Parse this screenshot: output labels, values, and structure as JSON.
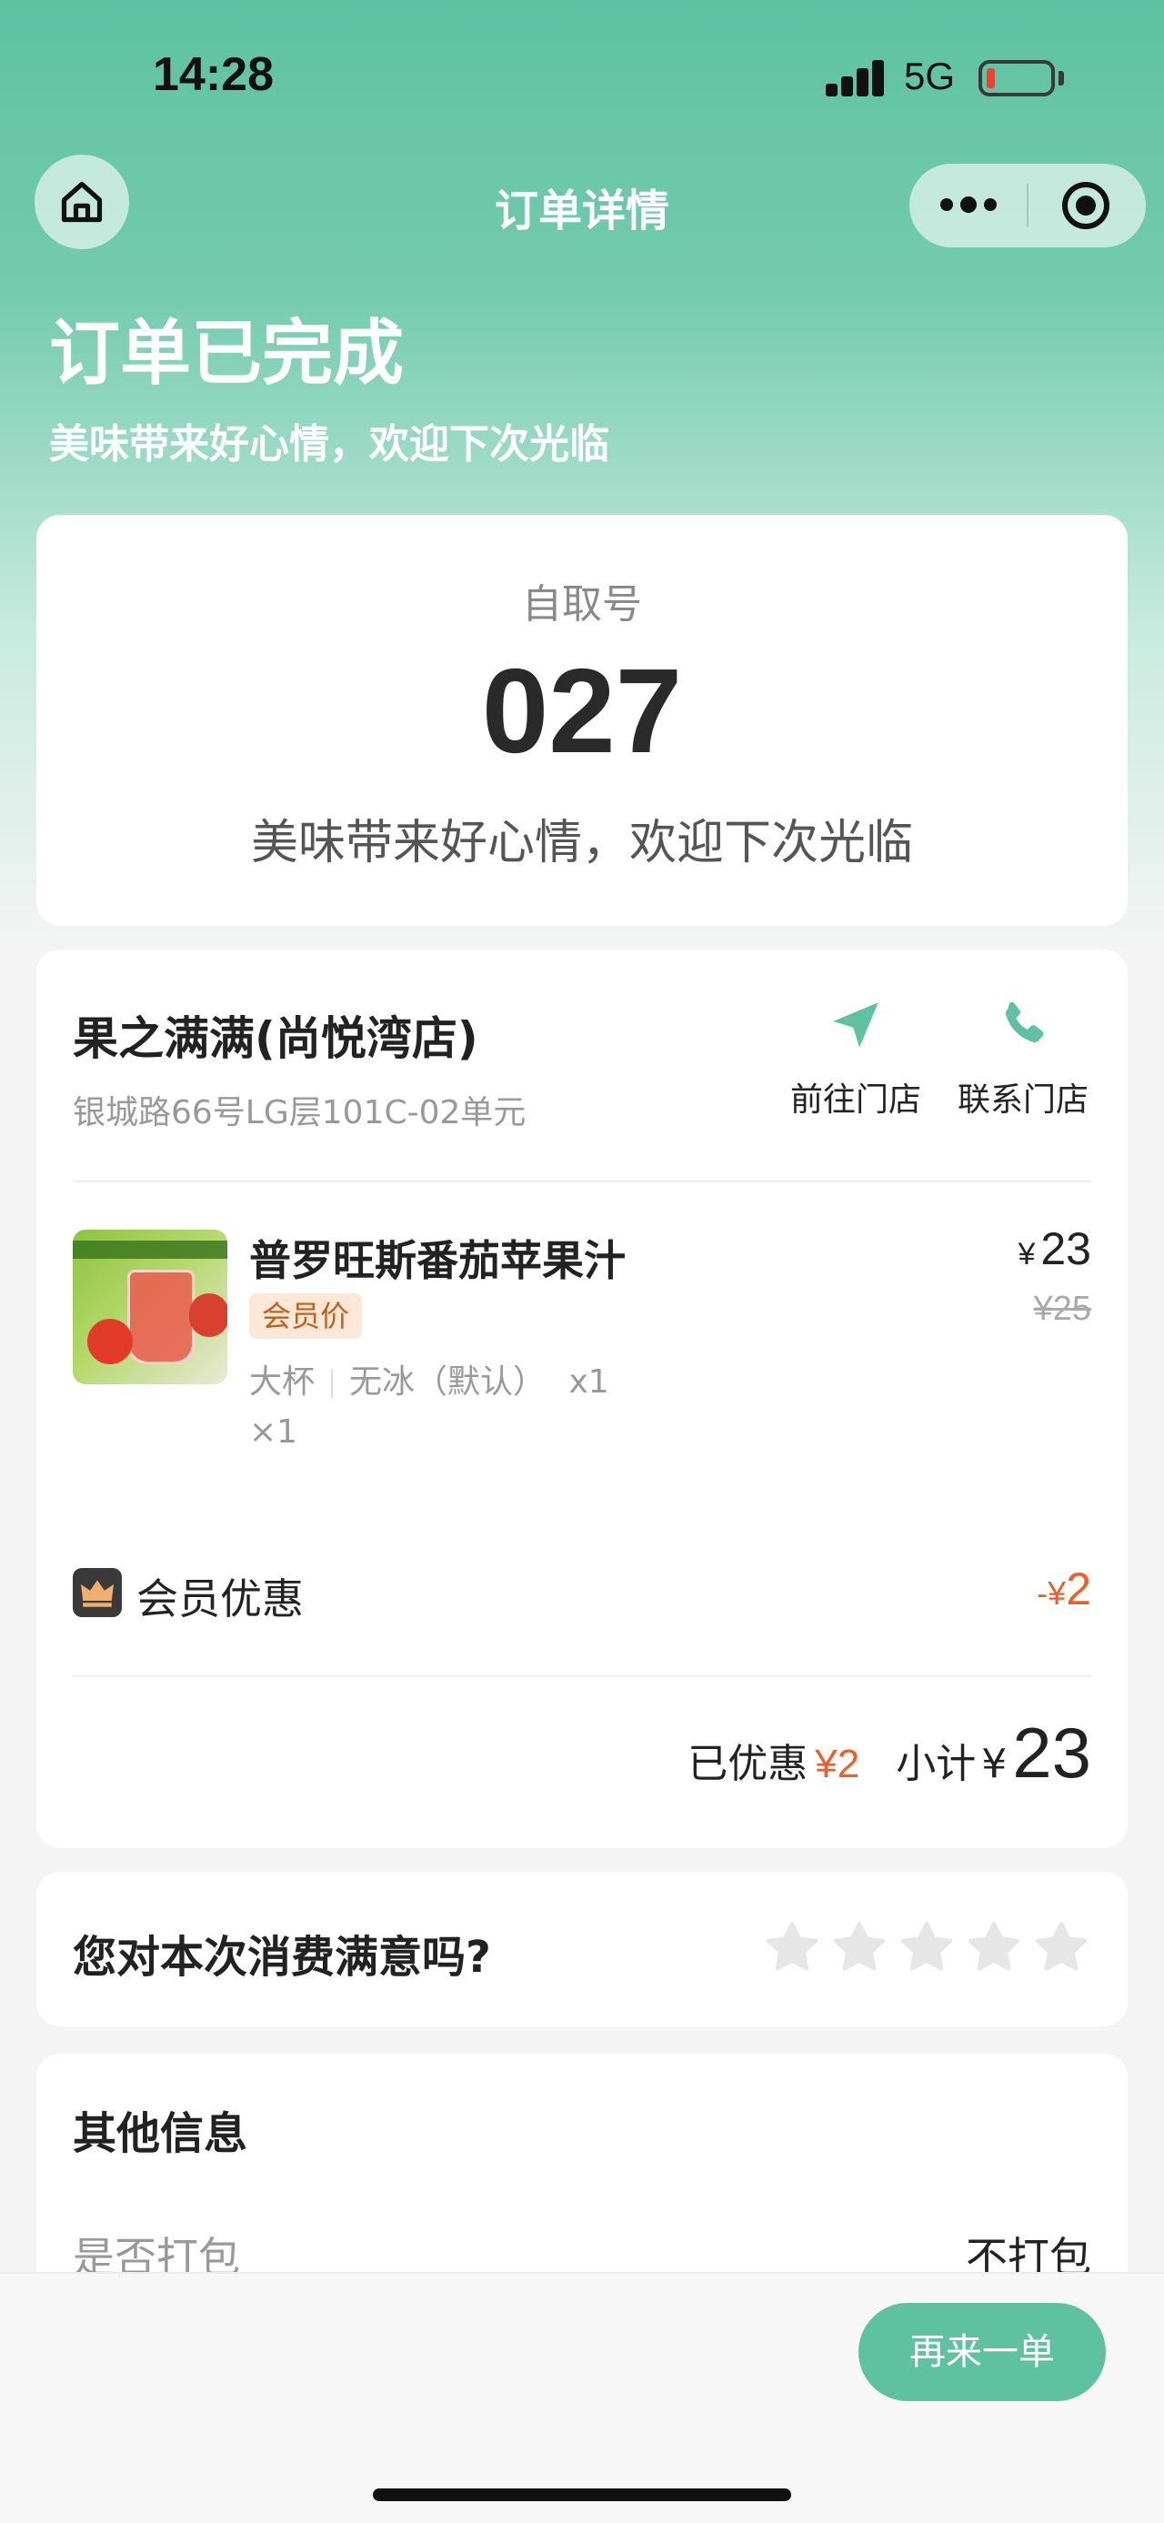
{
  "status_bar": {
    "time": "14:28",
    "network": "5G"
  },
  "nav": {
    "title": "订单详情",
    "home_icon": "home-icon",
    "more_icon": "more-dots-icon",
    "close_icon": "target-icon"
  },
  "order_status": {
    "title": "订单已完成",
    "subtitle": "美味带来好心情，欢迎下次光临"
  },
  "pickup": {
    "label": "自取号",
    "number": "027",
    "message": "美味带来好心情，欢迎下次光临"
  },
  "store": {
    "name": "果之满满(尚悦湾店)",
    "address": "银城路66号LG层101C-02单元",
    "navigate_label": "前往门店",
    "call_label": "联系门店"
  },
  "product": {
    "name": "普罗旺斯番茄苹果汁",
    "tag": "会员价",
    "size": "大杯",
    "ice": "无冰（默认）",
    "spec_qty": "x1",
    "qty": "×1",
    "price_symbol": "¥",
    "price": "23",
    "original_price": "¥25"
  },
  "member_discount": {
    "label": "会员优惠",
    "amount_prefix": "-",
    "symbol": "¥",
    "amount": "2"
  },
  "summary": {
    "saved_label": "已优惠",
    "saved_amount": "¥2",
    "subtotal_label": "小计",
    "subtotal_symbol": "¥",
    "subtotal": "23"
  },
  "rating": {
    "question": "您对本次消费满意吗?",
    "max_stars": 5,
    "selected": 0
  },
  "other_info": {
    "title": "其他信息",
    "pack_label": "是否打包",
    "pack_value": "不打包"
  },
  "footer": {
    "reorder_label": "再来一单"
  },
  "colors": {
    "primary": "#5ec2a1",
    "accent": "#e8612c",
    "tag_bg": "#fde8d8",
    "tag_text": "#c0601a"
  }
}
